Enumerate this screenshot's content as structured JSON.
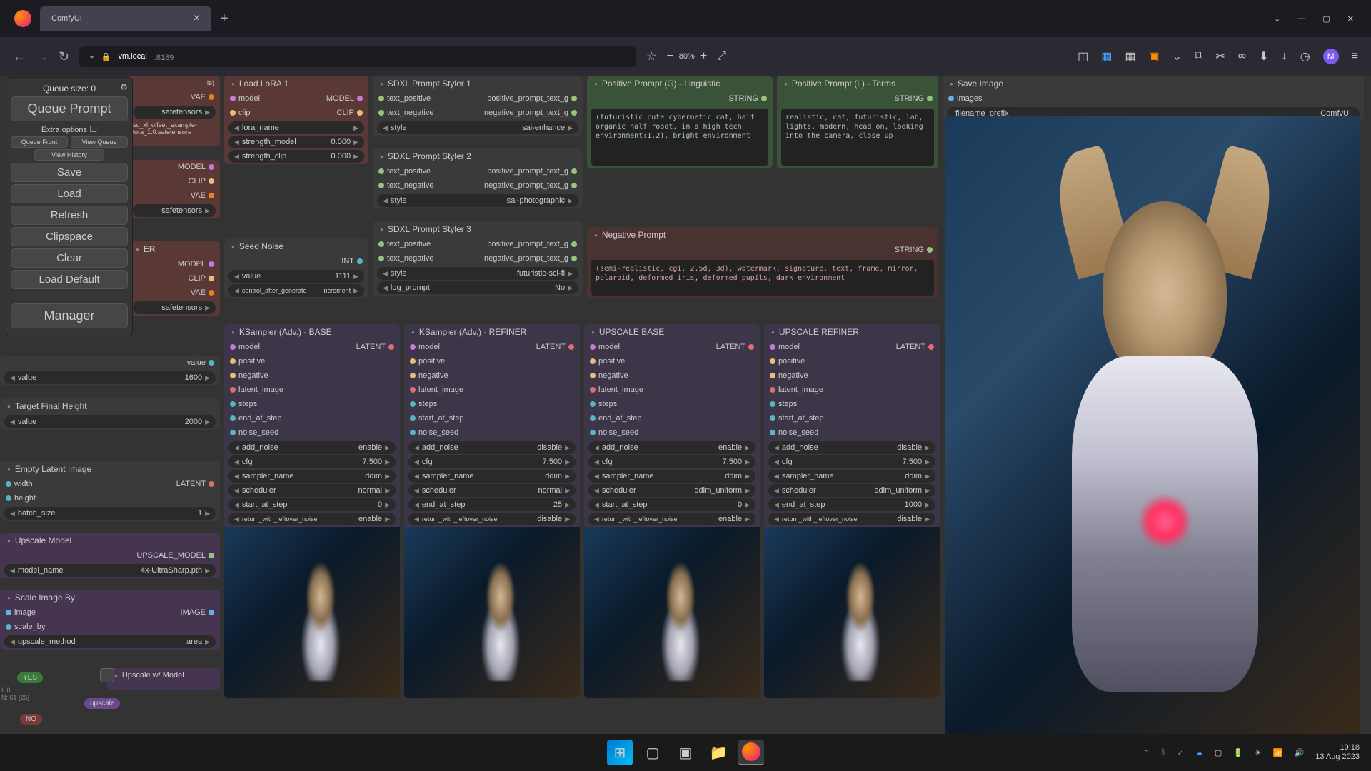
{
  "browser": {
    "tab_title": "ComfyUI",
    "url_host": "vm.local",
    "url_port": ":8189",
    "zoom": "80%"
  },
  "side_panel": {
    "queue_size": "Queue size: 0",
    "queue_prompt": "Queue Prompt",
    "extra_options": "Extra options",
    "queue_front": "Queue Front",
    "view_queue": "View Queue",
    "view_history": "View History",
    "save": "Save",
    "load": "Load",
    "refresh": "Refresh",
    "clipspace": "Clipspace",
    "clear": "Clear",
    "load_default": "Load Default",
    "manager": "Manager"
  },
  "partial_nodes": {
    "vae_out": "VAE",
    "safetensors1": "safetensors",
    "lora_file": "sd_xl_offset_example-lora_1.0.safetensors",
    "model_out": "MODEL",
    "clip_out": "CLIP",
    "safetensors2": "safetensors",
    "er_title": "ER",
    "safetensors3": "safetensors",
    "value_lbl": "value",
    "value_1600": "1600",
    "target_height": "Target Final Height",
    "value_2000": "2000",
    "empty_latent": "Empty Latent Image",
    "width": "width",
    "height": "height",
    "latent_out": "LATENT",
    "batch_size": "batch_size",
    "batch_val": "1",
    "upscale_model": "Upscale Model",
    "upscale_model_out": "UPSCALE_MODEL",
    "model_name": "model_name",
    "model_val": "4x-UltraSharp.pth",
    "scale_by": "Scale Image By",
    "image": "image",
    "image_out": "IMAGE",
    "scale_by_lbl": "scale_by",
    "upscale_method": "upscale_method",
    "area": "area",
    "upscale_w_model": "Upscale w/ Model",
    "yes": "YES",
    "no": "NO",
    "upscale_tag": "upscale",
    "debug": "I: 0\nN: 61 [25]"
  },
  "load_lora": {
    "title": "Load LoRA 1",
    "model": "model",
    "clip": "clip",
    "model_out": "MODEL",
    "clip_out": "CLIP",
    "lora_name": "lora_name",
    "strength_model": "strength_model",
    "strength_model_v": "0.000",
    "strength_clip": "strength_clip",
    "strength_clip_v": "0.000"
  },
  "seed": {
    "title": "Seed Noise",
    "int_out": "INT",
    "value": "value",
    "value_v": "1111",
    "control": "control_after_generate",
    "control_v": "increment"
  },
  "styler1": {
    "title": "SDXL Prompt Styler 1",
    "tp": "text_positive",
    "tn": "text_negative",
    "pp": "positive_prompt_text_g",
    "np": "negative_prompt_text_g",
    "style": "style",
    "style_v": "sai-enhance"
  },
  "styler2": {
    "title": "SDXL Prompt Styler 2",
    "style_v": "sai-photographic"
  },
  "styler3": {
    "title": "SDXL Prompt Styler 3",
    "style_v": "futuristic-sci-fi",
    "log": "log_prompt",
    "log_v": "No"
  },
  "pos_g": {
    "title": "Positive Prompt (G) - Linguistic",
    "string": "STRING",
    "text": "(futuristic cute cybernetic cat, half organic half robot, in a high tech environment:1.2), bright environment"
  },
  "pos_l": {
    "title": "Positive Prompt (L) - Terms",
    "text": "realistic, cat, futuristic, lab, lights, modern, head on, looking into the camera, close up"
  },
  "neg": {
    "title": "Negative Prompt",
    "text": "(semi-realistic, cgi, 2.5d, 3d), watermark, signature, text, frame, mirror, polaroid, deformed iris, deformed pupils, dark environment"
  },
  "save_image": {
    "title": "Save Image",
    "images": "images",
    "prefix": "filename_prefix",
    "prefix_v": "ComfyUI"
  },
  "ks": {
    "model": "model",
    "positive": "positive",
    "negative": "negative",
    "latent_image": "latent_image",
    "steps": "steps",
    "end_at_step": "end_at_step",
    "start_at_step": "start_at_step",
    "noise_seed": "noise_seed",
    "latent_out": "LATENT",
    "add_noise": "add_noise",
    "cfg": "cfg",
    "cfg_v": "7.500",
    "sampler_name": "sampler_name",
    "sampler_v": "ddim",
    "scheduler": "scheduler",
    "return_leftover": "return_with_leftover_noise"
  },
  "ks_base": {
    "title": "KSampler (Adv.) - BASE",
    "add_noise_v": "enable",
    "scheduler_v": "normal",
    "start_at_step_lbl": "start_at_step",
    "start_at_step_v": "0",
    "return_v": "enable"
  },
  "ks_refiner": {
    "title": "KSampler (Adv.) - REFINER",
    "add_noise_v": "disable",
    "scheduler_v": "normal",
    "end_at_step_v": "25",
    "return_v": "disable"
  },
  "up_base": {
    "title": "UPSCALE BASE",
    "add_noise_v": "enable",
    "scheduler_v": "ddim_uniform",
    "start_at_step_v": "0",
    "return_v": "enable"
  },
  "up_refiner": {
    "title": "UPSCALE REFINER",
    "add_noise_v": "disable",
    "scheduler_v": "ddim_uniform",
    "end_at_step_v": "1000",
    "return_v": "disable"
  },
  "taskbar": {
    "time": "19:18",
    "date": "13 Aug 2023"
  }
}
